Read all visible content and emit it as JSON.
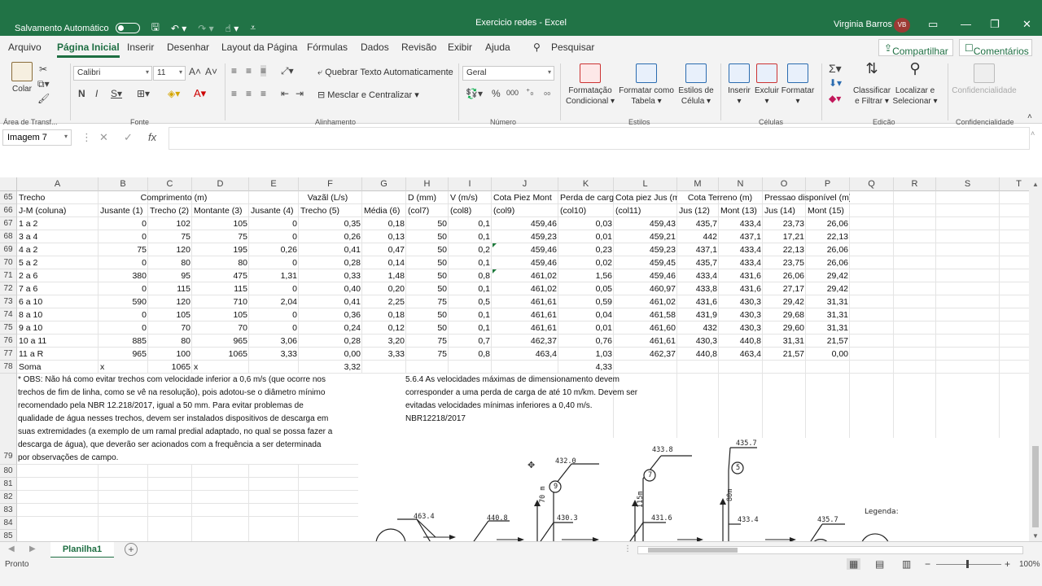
{
  "titlebar": {
    "autosave_label": "Salvamento Automático",
    "title": "Exercicio redes - Excel",
    "user_name": "Virginia Barros",
    "user_initials": "VB"
  },
  "menu": {
    "tabs": [
      "Arquivo",
      "Página Inicial",
      "Inserir",
      "Desenhar",
      "Layout da Página",
      "Fórmulas",
      "Dados",
      "Revisão",
      "Exibir",
      "Ajuda"
    ],
    "search": "Pesquisar",
    "share": "Compartilhar",
    "comments": "Comentários"
  },
  "ribbon": {
    "paste": "Colar",
    "clipboard_group": "Área de Transf...",
    "font_name": "Calibri",
    "font_size": "11",
    "font_group": "Fonte",
    "wrap_text": "Quebrar Texto Automaticamente",
    "merge_center": "Mesclar e Centralizar",
    "alignment_group": "Alinhamento",
    "number_format": "Geral",
    "number_group": "Número",
    "cond_format": "Formatação Condicional",
    "format_table": "Formatar como Tabela",
    "cell_styles": "Estilos de Célula",
    "styles_group": "Estilos",
    "insert": "Inserir",
    "delete": "Excluir",
    "format": "Formatar",
    "cells_group": "Células",
    "sort_filter": "Classificar e Filtrar",
    "find_select": "Localizar e Selecionar",
    "edit_group": "Edição",
    "sensitivity": "Confidencialidade",
    "sensitivity_group": "Confidencialidade"
  },
  "formula_bar": {
    "name_box": "Imagem 7",
    "fx": "fx",
    "content": ""
  },
  "columns": [
    "A",
    "B",
    "C",
    "D",
    "E",
    "F",
    "G",
    "H",
    "I",
    "J",
    "K",
    "L",
    "M",
    "N",
    "O",
    "P",
    "Q",
    "R",
    "S",
    "T"
  ],
  "rows": [
    {
      "num": "65",
      "cells": {
        "A": "Trecho",
        "BD": "Comprimento (m)",
        "EG": "Vazãl (L/s)",
        "H": "D (mm)",
        "I": "V (m/s)",
        "J": "Cota Piez Mont",
        "K": "Perda de carg",
        "L": "Cota piez Jus (m",
        "MN": "Cota Terreno (m)",
        "OP": "Pressao disponível (m)"
      }
    },
    {
      "num": "66",
      "cells": {
        "A": "J-M (coluna)",
        "B": "Jusante (1)",
        "C": "Trecho (2)",
        "D": "Montante (3)",
        "E": "Jusante (4)",
        "F": "Trecho (5)",
        "G": "Média (6)",
        "H": "(col7)",
        "I": "(col8)",
        "J": "(col9)",
        "K": "(col10)",
        "L": "(col11)",
        "M": "Jus (12)",
        "N": "Mont (13)",
        "O": "Jus (14)",
        "P": "Mont (15)"
      }
    },
    {
      "num": "67",
      "cells": {
        "A": "1 a 2",
        "B": "0",
        "C": "102",
        "D": "105",
        "E": "0",
        "F": "0,35",
        "G": "0,18",
        "H": "50",
        "I": "0,1",
        "J": "459,46",
        "K": "0,03",
        "L": "459,43",
        "M": "435,7",
        "N": "433,4",
        "O": "23,73",
        "P": "26,06"
      }
    },
    {
      "num": "68",
      "cells": {
        "A": "3 a 4",
        "B": "0",
        "C": "75",
        "D": "75",
        "E": "0",
        "F": "0,26",
        "G": "0,13",
        "H": "50",
        "I": "0,1",
        "J": "459,23",
        "K": "0,01",
        "L": "459,21",
        "M": "442",
        "N": "437,1",
        "O": "17,21",
        "P": "22,13"
      }
    },
    {
      "num": "69",
      "cells": {
        "A": "4 a 2",
        "B": "75",
        "C": "120",
        "D": "195",
        "E": "0,26",
        "F": "0,41",
        "G": "0,47",
        "H": "50",
        "I": "0,2",
        "J": "459,46",
        "K": "0,23",
        "L": "459,23",
        "M": "437,1",
        "N": "433,4",
        "O": "22,13",
        "P": "26,06"
      }
    },
    {
      "num": "70",
      "cells": {
        "A": "5 a 2",
        "B": "0",
        "C": "80",
        "D": "80",
        "E": "0",
        "F": "0,28",
        "G": "0,14",
        "H": "50",
        "I": "0,1",
        "J": "459,46",
        "K": "0,02",
        "L": "459,45",
        "M": "435,7",
        "N": "433,4",
        "O": "23,75",
        "P": "26,06"
      }
    },
    {
      "num": "71",
      "cells": {
        "A": "2 a 6",
        "B": "380",
        "C": "95",
        "D": "475",
        "E": "1,31",
        "F": "0,33",
        "G": "1,48",
        "H": "50",
        "I": "0,8",
        "J": "461,02",
        "K": "1,56",
        "L": "459,46",
        "M": "433,4",
        "N": "431,6",
        "O": "26,06",
        "P": "29,42"
      }
    },
    {
      "num": "72",
      "cells": {
        "A": "7 a 6",
        "B": "0",
        "C": "115",
        "D": "115",
        "E": "0",
        "F": "0,40",
        "G": "0,20",
        "H": "50",
        "I": "0,1",
        "J": "461,02",
        "K": "0,05",
        "L": "460,97",
        "M": "433,8",
        "N": "431,6",
        "O": "27,17",
        "P": "29,42"
      }
    },
    {
      "num": "73",
      "cells": {
        "A": "6 a 10",
        "B": "590",
        "C": "120",
        "D": "710",
        "E": "2,04",
        "F": "0,41",
        "G": "2,25",
        "H": "75",
        "I": "0,5",
        "J": "461,61",
        "K": "0,59",
        "L": "461,02",
        "M": "431,6",
        "N": "430,3",
        "O": "29,42",
        "P": "31,31"
      }
    },
    {
      "num": "74",
      "cells": {
        "A": "8 a 10",
        "B": "0",
        "C": "105",
        "D": "105",
        "E": "0",
        "F": "0,36",
        "G": "0,18",
        "H": "50",
        "I": "0,1",
        "J": "461,61",
        "K": "0,04",
        "L": "461,58",
        "M": "431,9",
        "N": "430,3",
        "O": "29,68",
        "P": "31,31"
      }
    },
    {
      "num": "75",
      "cells": {
        "A": "9 a 10",
        "B": "0",
        "C": "70",
        "D": "70",
        "E": "0",
        "F": "0,24",
        "G": "0,12",
        "H": "50",
        "I": "0,1",
        "J": "461,61",
        "K": "0,01",
        "L": "461,60",
        "M": "432",
        "N": "430,3",
        "O": "29,60",
        "P": "31,31"
      }
    },
    {
      "num": "76",
      "cells": {
        "A": "10 a 11",
        "B": "885",
        "C": "80",
        "D": "965",
        "E": "3,06",
        "F": "0,28",
        "G": "3,20",
        "H": "75",
        "I": "0,7",
        "J": "462,37",
        "K": "0,76",
        "L": "461,61",
        "M": "430,3",
        "N": "440,8",
        "O": "31,31",
        "P": "21,57"
      }
    },
    {
      "num": "77",
      "cells": {
        "A": "11 a R",
        "B": "965",
        "C": "100",
        "D": "1065",
        "E": "3,33",
        "F": "0,00",
        "G": "3,33",
        "H": "75",
        "I": "0,8",
        "J": "463,4",
        "K": "1,03",
        "L": "462,37",
        "M": "440,8",
        "N": "463,4",
        "O": "21,57",
        "P": "0,00"
      }
    },
    {
      "num": "78",
      "cells": {
        "A": "Soma",
        "B": "x",
        "C": "1065",
        "D": "x",
        "F": "3,32",
        "K": "4,33"
      }
    }
  ],
  "note_left": [
    "* OBS: Não há como evitar trechos com velocidade inferior a 0,6 m/s (que ocorre nos",
    "trechos de fim de linha, como se vê na resolução), pois adotou-se o diâmetro mínimo",
    "recomendado pela NBR 12.218/2017, igual a 50 mm. Para evitar problemas de",
    "qualidade de água nesses trechos, devem ser instalados dispositivos de descarga em",
    "suas extremidades (a exemplo de um ramal predial adaptado, no qual se possa fazer a",
    "descarga de água), que deverão ser acionados com a frequência a ser determinada",
    "por observações de campo."
  ],
  "note_right": [
    "5.6.4 As velocidades máximas de dimensionamento devem",
    "corresponder a uma perda de carga de até 10 m/km. Devem ser",
    "evitadas velocidades mínimas inferiores a 0,40 m/s.",
    "NBR12218/2017"
  ],
  "extra_rows": [
    "79",
    "80",
    "81",
    "82",
    "83",
    "84",
    "85"
  ],
  "diagram": {
    "labels": [
      "463.4",
      "440.8",
      "432.0",
      "430.3",
      "433.8",
      "431.6",
      "435.7",
      "433.4",
      "435.7",
      "Legenda:"
    ],
    "nodes": [
      "9",
      "7",
      "5"
    ],
    "lengths": [
      "70 m",
      "115m",
      "80m"
    ]
  },
  "sheet_tab": "Planilha1",
  "status": {
    "ready": "Pronto",
    "zoom": "100%"
  }
}
